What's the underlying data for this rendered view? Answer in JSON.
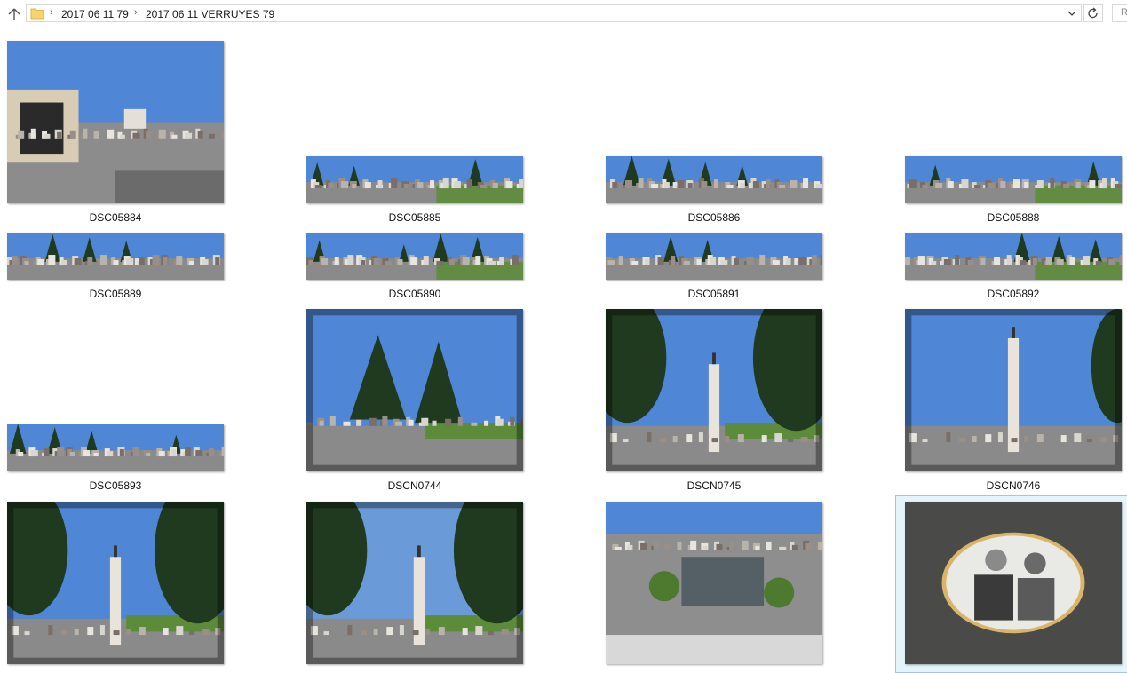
{
  "address_bar": {
    "breadcrumbs": [
      "2017 06 11  79",
      "2017 06 11 VERRUYES 79"
    ],
    "search_placeholder": "R"
  },
  "files": [
    {
      "name": "DSC05884",
      "kind": "tall-gate"
    },
    {
      "name": "DSC05885",
      "kind": "pano-a"
    },
    {
      "name": "DSC05886",
      "kind": "pano-b"
    },
    {
      "name": "DSC05888",
      "kind": "pano-c"
    },
    {
      "name": "DSC05889",
      "kind": "pano-d"
    },
    {
      "name": "DSC05890",
      "kind": "pano-e"
    },
    {
      "name": "DSC05891",
      "kind": "pano-f"
    },
    {
      "name": "DSC05892",
      "kind": "pano-g"
    },
    {
      "name": "DSC05893",
      "kind": "pano-h"
    },
    {
      "name": "DSCN0744",
      "kind": "tall-trees"
    },
    {
      "name": "DSCN0745",
      "kind": "tall-column"
    },
    {
      "name": "DSCN0746",
      "kind": "tall-column-sky"
    },
    {
      "name": "",
      "kind": "tall-column-trees"
    },
    {
      "name": "",
      "kind": "tall-dark-trees"
    },
    {
      "name": "",
      "kind": "tall-graves"
    },
    {
      "name": "",
      "kind": "tall-portrait"
    }
  ],
  "colors": {
    "sky": "#4f86d6",
    "ground": "#8a8a8a",
    "grass": "#5c8c3a",
    "tree": "#1f3a1f",
    "selection_bg": "#e5f3fb",
    "selection_border": "#99c9ef"
  }
}
